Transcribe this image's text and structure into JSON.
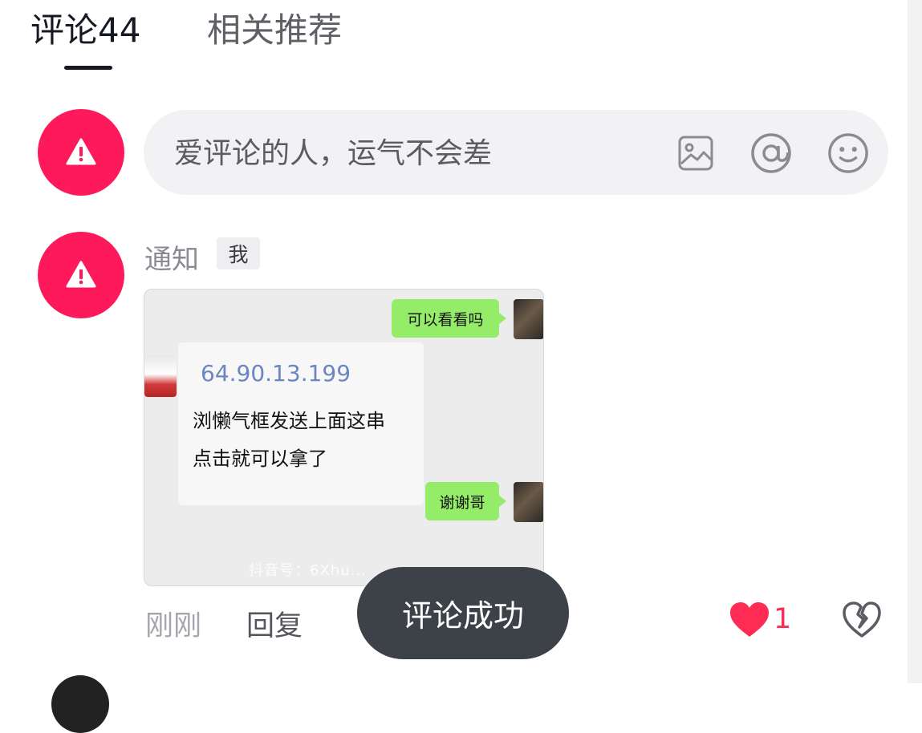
{
  "tabs": {
    "comments_label": "评论44",
    "related_label": "相关推荐"
  },
  "comment_input": {
    "placeholder": "爱评论的人，运气不会差",
    "icons": [
      "image-icon",
      "at-icon",
      "emoji-icon"
    ]
  },
  "comment": {
    "author": "通知",
    "badge": "我",
    "time": "刚刚",
    "reply_label": "回复",
    "like_count": "1",
    "image": {
      "bubble_top": "可以看看吗",
      "ip_text": "64.90.13.199",
      "line1": "浏懒气框发送上面这串",
      "line2": "点击就可以拿了",
      "bubble_bottom": "谢谢哥",
      "watermark": "抖音号：6Xhu..."
    }
  },
  "toast": {
    "message": "评论成功"
  },
  "colors": {
    "accent": "#fe2c55",
    "avatar": "#fe1a5a",
    "toast_bg": "#3d4148"
  }
}
